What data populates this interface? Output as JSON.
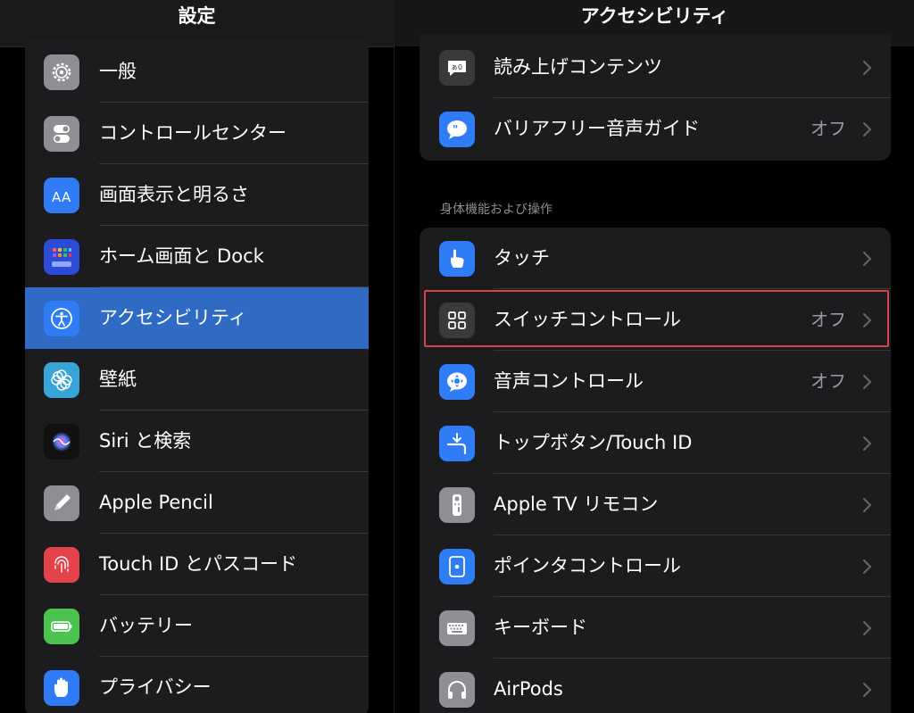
{
  "settings_sidebar": {
    "title": "設定",
    "items": [
      {
        "label": "一般",
        "icon": "gear-icon",
        "color": "#8e8e93"
      },
      {
        "label": "コントロールセンター",
        "icon": "toggles-icon",
        "color": "#8e8e93"
      },
      {
        "label": "画面表示と明るさ",
        "icon": "text-size-icon",
        "color": "#2f7cf6"
      },
      {
        "label": "ホーム画面と Dock",
        "icon": "home-grid-icon",
        "color": "#2c4bd6"
      },
      {
        "label": "アクセシビリティ",
        "icon": "accessibility-icon",
        "color": "#2f7cf6",
        "selected": true
      },
      {
        "label": "壁紙",
        "icon": "flower-icon",
        "color": "#37a5d8"
      },
      {
        "label": "Siri と検索",
        "icon": "siri-icon",
        "color": "#111111"
      },
      {
        "label": "Apple Pencil",
        "icon": "pencil-icon",
        "color": "#8e8e93"
      },
      {
        "label": "Touch ID とパスコード",
        "icon": "fingerprint-icon",
        "color": "#e5434b"
      },
      {
        "label": "バッテリー",
        "icon": "battery-icon",
        "color": "#4cc34f"
      },
      {
        "label": "プライバシー",
        "icon": "hand-icon",
        "color": "#2f7cf6"
      }
    ]
  },
  "accessibility": {
    "title": "アクセシビリティ",
    "group1": [
      {
        "label": "読み上げコンテンツ",
        "icon": "speech-bubble-icon",
        "color": "#3a3a3c",
        "value": ""
      },
      {
        "label": "バリアフリー音声ガイド",
        "icon": "quote-bubble-icon",
        "color": "#2f7cf6",
        "value": "オフ"
      }
    ],
    "section_header": "身体機能および操作",
    "group2": [
      {
        "label": "タッチ",
        "icon": "touch-hand-icon",
        "color": "#2f7cf6",
        "value": ""
      },
      {
        "label": "スイッチコントロール",
        "icon": "switch-grid-icon",
        "color": "#3a3a3c",
        "value": "オフ"
      },
      {
        "label": "音声コントロール",
        "icon": "voice-control-icon",
        "color": "#2f7cf6",
        "value": "オフ"
      },
      {
        "label": "トップボタン/Touch ID",
        "icon": "top-button-icon",
        "color": "#2f7cf6",
        "value": ""
      },
      {
        "label": "Apple TV リモコン",
        "icon": "remote-icon",
        "color": "#8e8e93",
        "value": ""
      },
      {
        "label": "ポインタコントロール",
        "icon": "pointer-icon",
        "color": "#2f7cf6",
        "value": ""
      },
      {
        "label": "キーボード",
        "icon": "keyboard-icon",
        "color": "#8e8e93",
        "value": ""
      },
      {
        "label": "AirPods",
        "icon": "headphones-icon",
        "color": "#8e8e93",
        "value": ""
      }
    ]
  },
  "colors": {
    "accent": "#2f6bc4",
    "highlight_box": "#d9424a",
    "group_bg": "#1c1c1e",
    "secondary_text": "#98989f"
  }
}
